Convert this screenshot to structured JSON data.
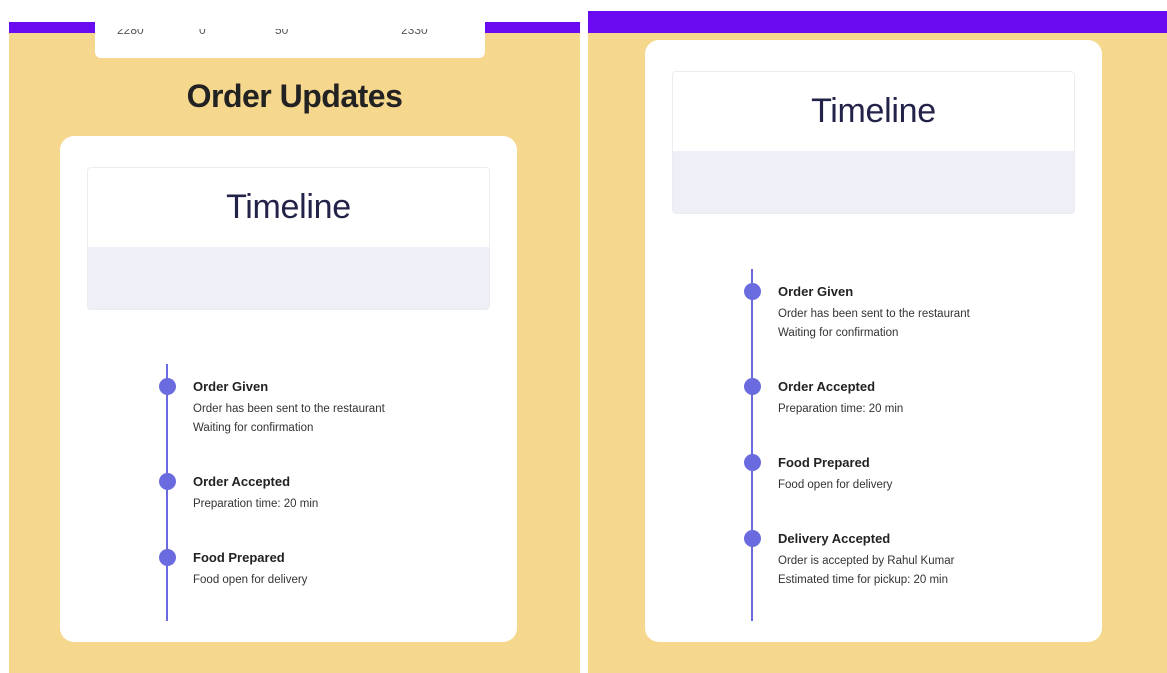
{
  "left_panel": {
    "stats": [
      "2280",
      "0",
      "50",
      "2330"
    ],
    "heading": "Order Updates",
    "timeline_title": "Timeline",
    "events": [
      {
        "title": "Order Given",
        "lines": [
          "Order has been sent to the restaurant",
          "Waiting for confirmation"
        ]
      },
      {
        "title": "Order Accepted",
        "lines": [
          "Preparation time: 20 min"
        ]
      },
      {
        "title": "Food Prepared",
        "lines": [
          "Food open for delivery"
        ]
      }
    ]
  },
  "right_panel": {
    "timeline_title": "Timeline",
    "events": [
      {
        "title": "Order Given",
        "lines": [
          "Order has been sent to the restaurant",
          "Waiting for confirmation"
        ]
      },
      {
        "title": "Order Accepted",
        "lines": [
          "Preparation time: 20 min"
        ]
      },
      {
        "title": "Food Prepared",
        "lines": [
          "Food open for delivery"
        ]
      },
      {
        "title": "Delivery Accepted",
        "lines": [
          "Order is accepted by Rahul Kumar",
          "Estimated time for pickup: 20 min"
        ]
      }
    ]
  },
  "colors": {
    "background": "#f5d78e",
    "top_bar": "#6a0af0",
    "timeline_accent": "#6b6be0"
  }
}
